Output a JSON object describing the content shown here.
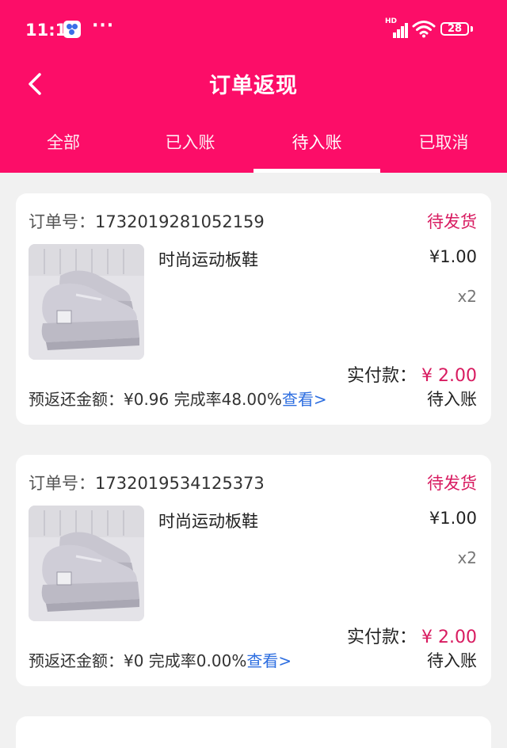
{
  "status_bar": {
    "time": "11:11",
    "dots": "···",
    "network": "HD",
    "battery": "28"
  },
  "header": {
    "title": "订单返现"
  },
  "tabs": [
    {
      "label": "全部",
      "active": false
    },
    {
      "label": "已入账",
      "active": false
    },
    {
      "label": "待入账",
      "active": true
    },
    {
      "label": "已取消",
      "active": false
    }
  ],
  "orders": [
    {
      "order_label": "订单号：",
      "order_no": "1732019281052159",
      "status": "待发货",
      "product_name": "时尚运动板鞋",
      "unit_price": "¥1.00",
      "quantity": "x2",
      "paid_label": "实付款：",
      "paid_amount": "¥ 2.00",
      "rebate_text": "预返还金额：¥0.96 完成率48.00%",
      "view_link": "查看>",
      "entry_status": "待入账"
    },
    {
      "order_label": "订单号：",
      "order_no": "1732019534125373",
      "status": "待发货",
      "product_name": "时尚运动板鞋",
      "unit_price": "¥1.00",
      "quantity": "x2",
      "paid_label": "实付款：",
      "paid_amount": "¥ 2.00",
      "rebate_text": "预返还金额：¥0 完成率0.00%",
      "view_link": "查看>",
      "entry_status": "待入账"
    }
  ],
  "colors": {
    "brand": "#fc0d68",
    "accent_text": "#d81b60",
    "link": "#2d6ee0",
    "background": "#f1f1f1"
  },
  "icons": {
    "back": "chevron-left-icon",
    "wifi": "wifi-icon",
    "signal": "signal-icon",
    "battery": "battery-icon"
  }
}
